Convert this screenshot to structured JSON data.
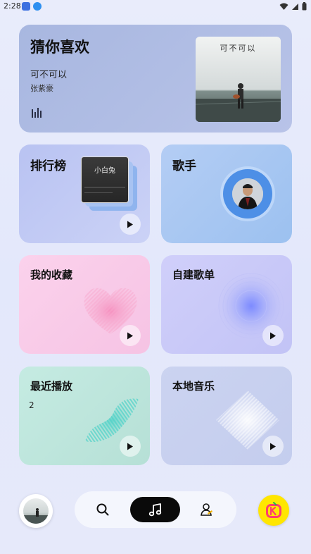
{
  "status": {
    "time": "2:28"
  },
  "hero": {
    "title": "猜你喜欢",
    "song": "可不可以",
    "artist": "张紫豪",
    "cover_text": "可不可以"
  },
  "cards": {
    "charts": {
      "title": "排行榜",
      "thumb_text": "小白兔"
    },
    "singers": {
      "title": "歌手"
    },
    "favorites": {
      "title": "我的收藏"
    },
    "playlists": {
      "title": "自建歌单"
    },
    "recent": {
      "title": "最近播放",
      "count": "2"
    },
    "local": {
      "title": "本地音乐"
    }
  },
  "nav": {
    "items": [
      {
        "icon": "search-icon"
      },
      {
        "icon": "music-note-icon",
        "active": true
      },
      {
        "icon": "profile-icon"
      }
    ]
  },
  "colors": {
    "accent": "#0a0a0a",
    "brand_badge": "#ffe600",
    "favorites_bg": "#f8c5e6",
    "recent_bg": "#b8e2d8",
    "singers_bg": "#a8c7f2",
    "playlists_bg": "#c9c8f8"
  }
}
